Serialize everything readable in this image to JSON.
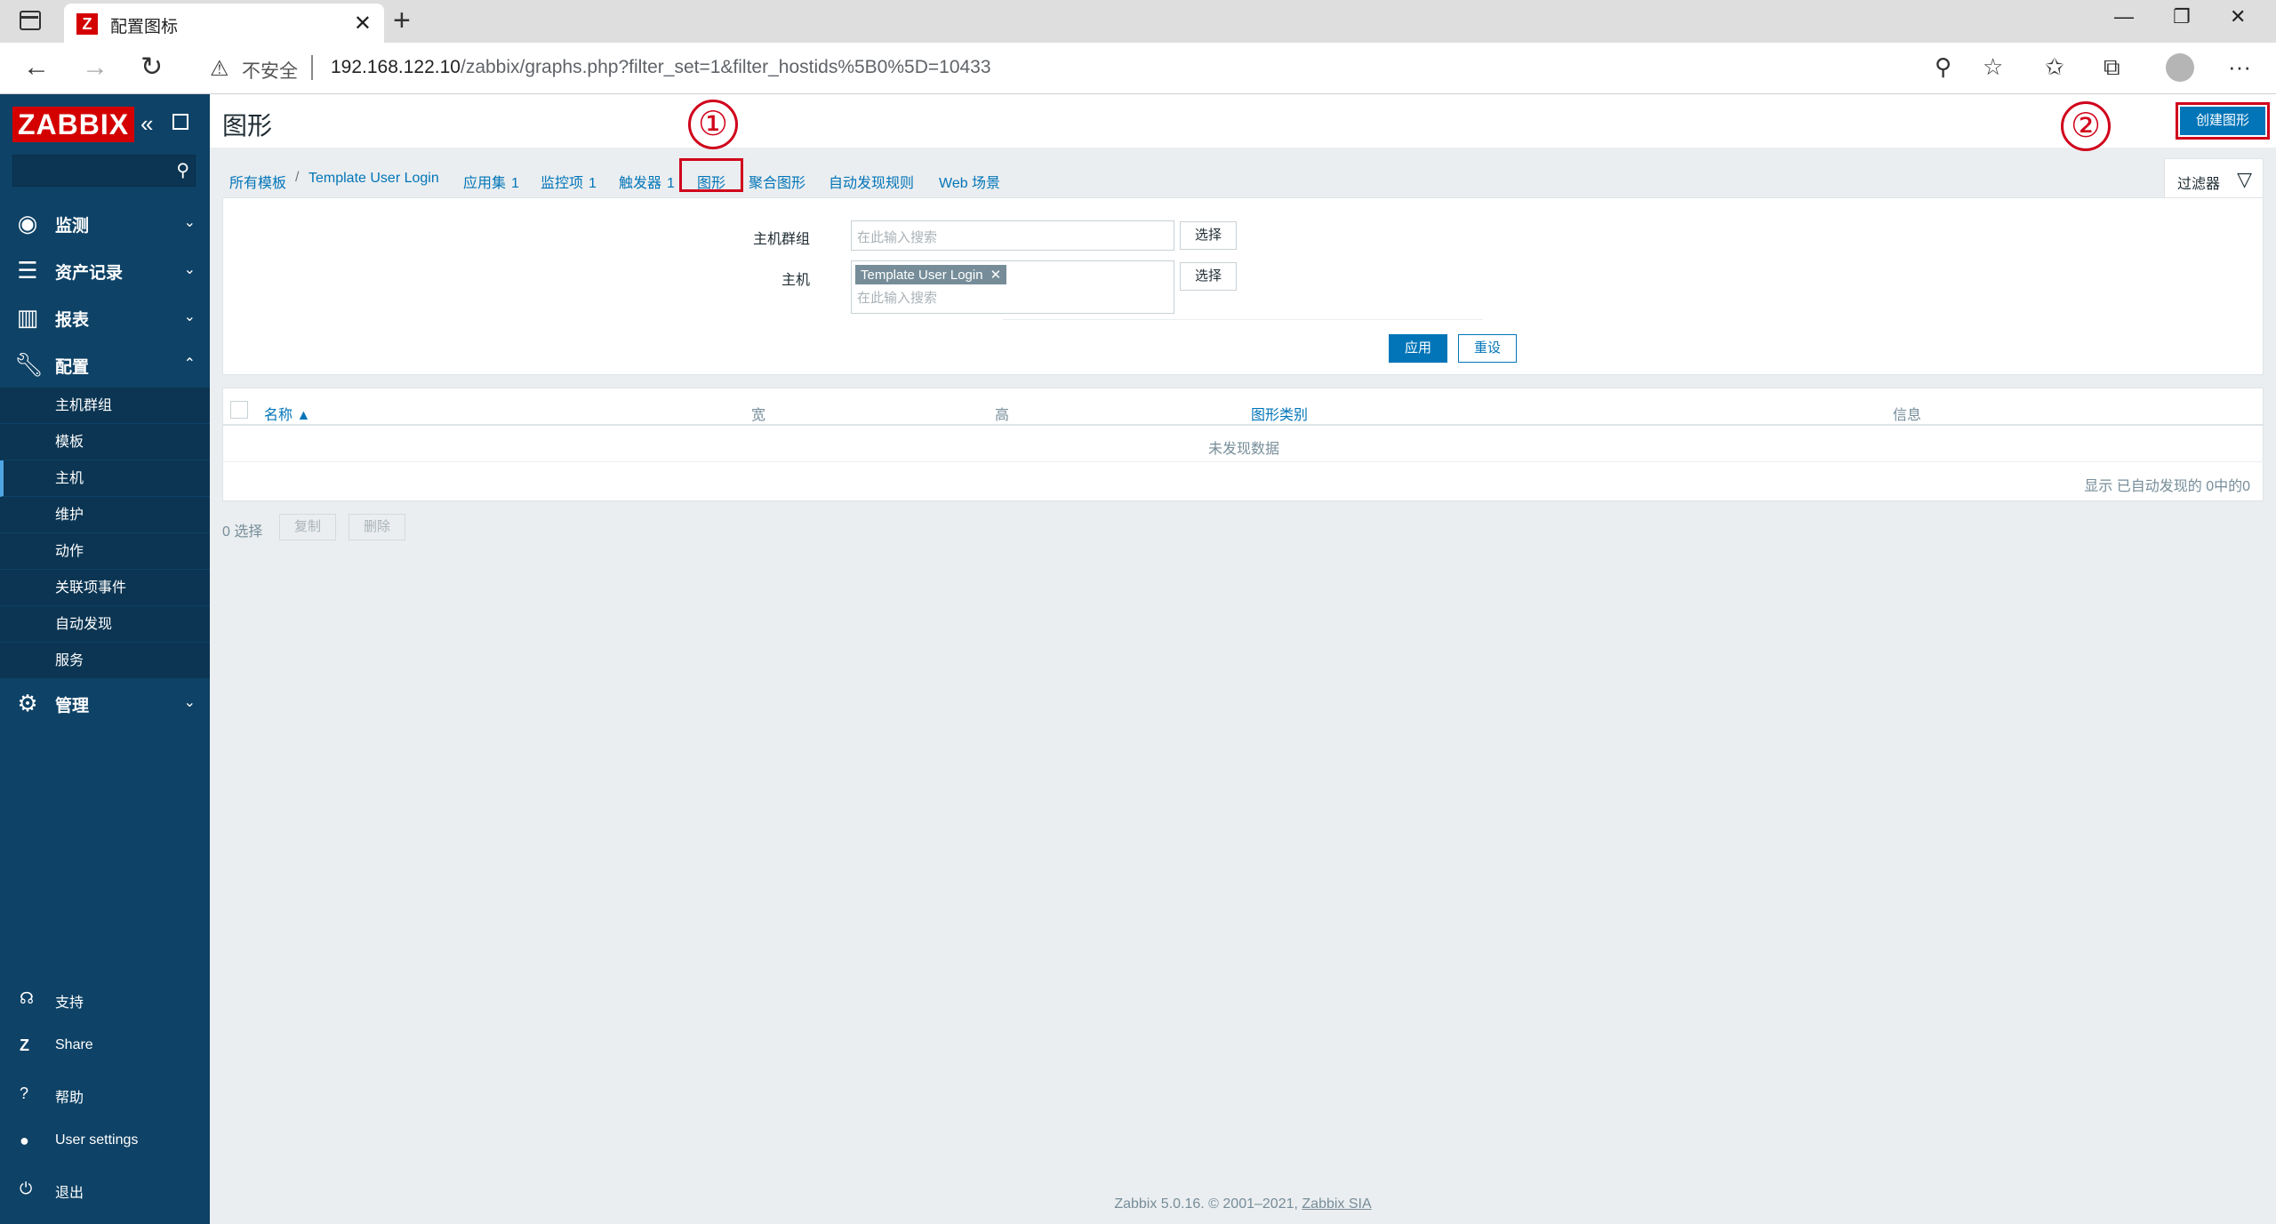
{
  "browser": {
    "tab_title": "配置图标",
    "tab_favicon": "Z",
    "url_warning": "不安全",
    "url_host": "192.168.122.10",
    "url_path": "/zabbix/graphs.php?filter_set=1&filter_hostids%5B0%5D=10433"
  },
  "sidebar": {
    "logo": "ZABBIX",
    "menu": [
      {
        "label": "监测",
        "icon": "eye-icon"
      },
      {
        "label": "资产记录",
        "icon": "list-icon"
      },
      {
        "label": "报表",
        "icon": "bar-chart-icon"
      },
      {
        "label": "配置",
        "icon": "wrench-icon"
      },
      {
        "label": "管理",
        "icon": "gear-icon"
      }
    ],
    "submenu": [
      "主机群组",
      "模板",
      "主机",
      "维护",
      "动作",
      "关联项事件",
      "自动发现",
      "服务"
    ],
    "bottom": [
      {
        "label": "支持",
        "icon": "headset-icon"
      },
      {
        "label": "Share",
        "icon": "share-z-icon"
      },
      {
        "label": "帮助",
        "icon": "help-icon"
      },
      {
        "label": "User settings",
        "icon": "user-icon"
      },
      {
        "label": "退出",
        "icon": "power-icon"
      }
    ]
  },
  "header": {
    "title": "图形",
    "create_button": "创建图形"
  },
  "annotations": {
    "one": "①",
    "two": "②"
  },
  "breadcrumb": {
    "all_templates": "所有模板",
    "sep": "/",
    "template": "Template User Login",
    "applications": "应用集",
    "applications_count": "1",
    "items": "监控项",
    "items_count": "1",
    "triggers": "触发器",
    "triggers_count": "1",
    "graphs": "图形",
    "screens": "聚合图形",
    "discovery": "自动发现规则",
    "web": "Web 场景"
  },
  "filter": {
    "tab_label": "过滤器",
    "host_group_label": "主机群组",
    "host_label": "主机",
    "placeholder": "在此输入搜索",
    "select_button": "选择",
    "host_tag": "Template User Login",
    "apply": "应用",
    "reset": "重设"
  },
  "table": {
    "columns": [
      "名称 ▲",
      "宽",
      "高",
      "图形类别",
      "信息"
    ],
    "no_data": "未发现数据",
    "paging": "显示 已自动发现的 0中的0"
  },
  "actions": {
    "selected": "0 选择",
    "copy": "复制",
    "delete": "删除"
  },
  "footer": {
    "text": "Zabbix 5.0.16. © 2001–2021, ",
    "link": "Zabbix SIA"
  }
}
